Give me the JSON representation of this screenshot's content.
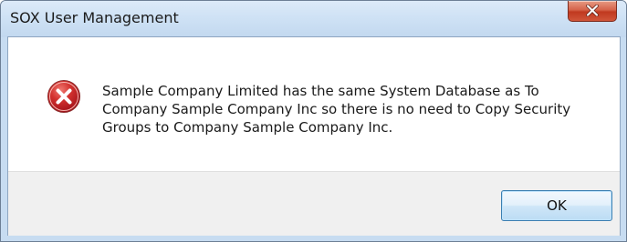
{
  "window": {
    "title": "SOX User Management"
  },
  "dialog": {
    "icon": "error-icon",
    "message": "Sample Company Limited has the same System Database as To Company Sample Company Inc so there is no need to Copy Security Groups to Company Sample Company Inc.",
    "ok_label": "OK"
  },
  "colors": {
    "title_bar": "#cfe2f5",
    "close_button": "#c8442a",
    "error_icon": "#c8262e",
    "button_bar": "#f0f0f0",
    "ok_border": "#3c7fb1"
  },
  "icons": {
    "close": "close-icon",
    "error": "error-icon"
  }
}
